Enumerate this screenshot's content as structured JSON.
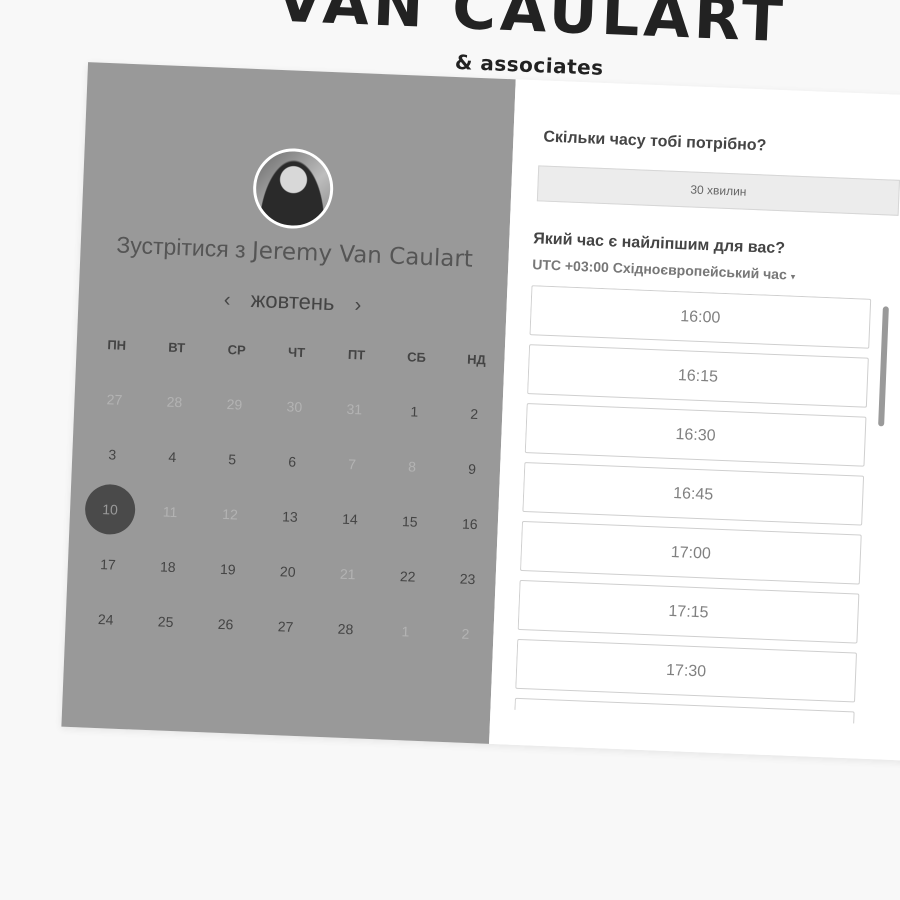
{
  "brand": {
    "name": "VAN CAULART",
    "subtitle": "& associates"
  },
  "booking": {
    "meet_prefix": "Зустрітися з",
    "host_name": "Jeremy Van Caulart",
    "month": "жовтень",
    "prev_icon": "‹",
    "next_icon": "›",
    "weekdays": [
      "ПН",
      "ВТ",
      "СР",
      "ЧТ",
      "ПТ",
      "СБ",
      "НД"
    ],
    "weeks": [
      [
        {
          "d": "27",
          "muted": true
        },
        {
          "d": "28",
          "muted": true
        },
        {
          "d": "29",
          "muted": true
        },
        {
          "d": "30",
          "muted": true
        },
        {
          "d": "31",
          "muted": true
        },
        {
          "d": "1"
        },
        {
          "d": "2"
        }
      ],
      [
        {
          "d": "3"
        },
        {
          "d": "4"
        },
        {
          "d": "5"
        },
        {
          "d": "6"
        },
        {
          "d": "7",
          "muted": true
        },
        {
          "d": "8",
          "muted": true
        },
        {
          "d": "9"
        }
      ],
      [
        {
          "d": "10",
          "selected": true
        },
        {
          "d": "11",
          "muted": true
        },
        {
          "d": "12",
          "muted": true
        },
        {
          "d": "13"
        },
        {
          "d": "14"
        },
        {
          "d": "15"
        },
        {
          "d": "16"
        }
      ],
      [
        {
          "d": "17"
        },
        {
          "d": "18"
        },
        {
          "d": "19"
        },
        {
          "d": "20"
        },
        {
          "d": "21",
          "muted": true
        },
        {
          "d": "22"
        },
        {
          "d": "23"
        }
      ],
      [
        {
          "d": "24"
        },
        {
          "d": "25"
        },
        {
          "d": "26"
        },
        {
          "d": "27"
        },
        {
          "d": "28"
        },
        {
          "d": "1",
          "muted": true
        },
        {
          "d": "2",
          "muted": true
        }
      ]
    ]
  },
  "scheduler": {
    "duration_question": "Скільки часу тобі потрібно?",
    "duration_value": "30 хвилин",
    "time_question": "Який час є найліпшим для вас?",
    "timezone": "UTC +03:00 Східноєвропейський час",
    "timezone_caret": "▾",
    "slots": [
      "16:00",
      "16:15",
      "16:30",
      "16:45",
      "17:00",
      "17:15",
      "17:30",
      ""
    ]
  },
  "colors": {
    "left_panel": "#999999",
    "selected_day": "#4a4a4a",
    "page_bg": "#f8f8f8"
  }
}
